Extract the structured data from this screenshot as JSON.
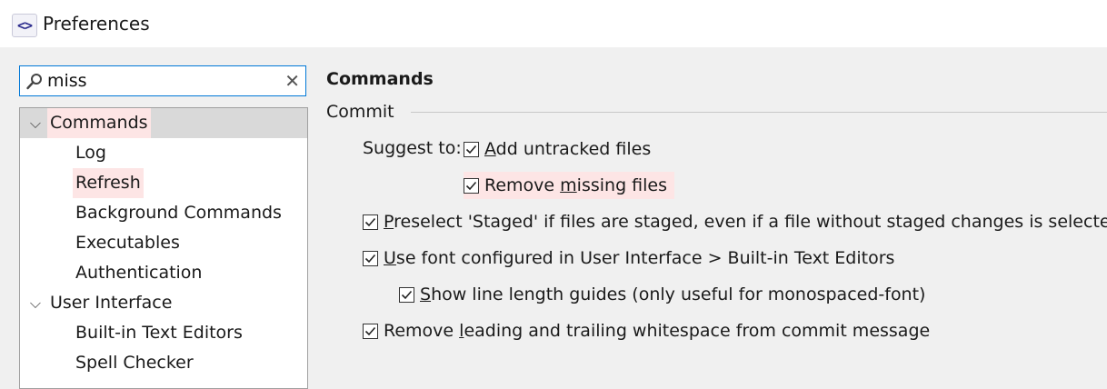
{
  "window": {
    "title": "Preferences",
    "icon": "code-brackets-icon"
  },
  "search": {
    "value": "miss",
    "placeholder": ""
  },
  "tree": {
    "items": [
      {
        "label": "Commands",
        "level": 0,
        "expanded": true,
        "selected": true,
        "highlight": true
      },
      {
        "label": "Log",
        "level": 1
      },
      {
        "label": "Refresh",
        "level": 1,
        "highlight": true
      },
      {
        "label": "Background Commands",
        "level": 1
      },
      {
        "label": "Executables",
        "level": 1
      },
      {
        "label": "Authentication",
        "level": 1
      },
      {
        "label": "User Interface",
        "level": 0,
        "expanded": true
      },
      {
        "label": "Built-in Text Editors",
        "level": 1
      },
      {
        "label": "Spell Checker",
        "level": 1
      }
    ]
  },
  "page": {
    "title": "Commands",
    "group": "Commit",
    "suggest_label": "Suggest to:",
    "options": [
      {
        "id": "add-untracked",
        "mnemonic": "A",
        "rest": "dd untracked files",
        "checked": true
      },
      {
        "id": "remove-missing",
        "pre": "Remove ",
        "mnemonic": "m",
        "rest": "issing files",
        "checked": true,
        "highlight": true
      },
      {
        "id": "preselect-staged",
        "mnemonic": "P",
        "rest": "reselect 'Staged' if files are staged, even if a file without staged changes is selected",
        "checked": true
      },
      {
        "id": "use-font",
        "mnemonic": "U",
        "rest": "se font configured in User Interface > Built-in Text Editors",
        "checked": true
      },
      {
        "id": "line-length",
        "mnemonic": "S",
        "rest": "how line length guides (only useful for monospaced-font)",
        "checked": true
      },
      {
        "id": "remove-whitespace",
        "pre": "Remove ",
        "mnemonic": "l",
        "rest": "eading and trailing whitespace from commit message",
        "checked": true
      }
    ]
  },
  "colors": {
    "highlight": "#fde5e5",
    "selection": "#d9d9d9",
    "focus": "#0078d7"
  }
}
